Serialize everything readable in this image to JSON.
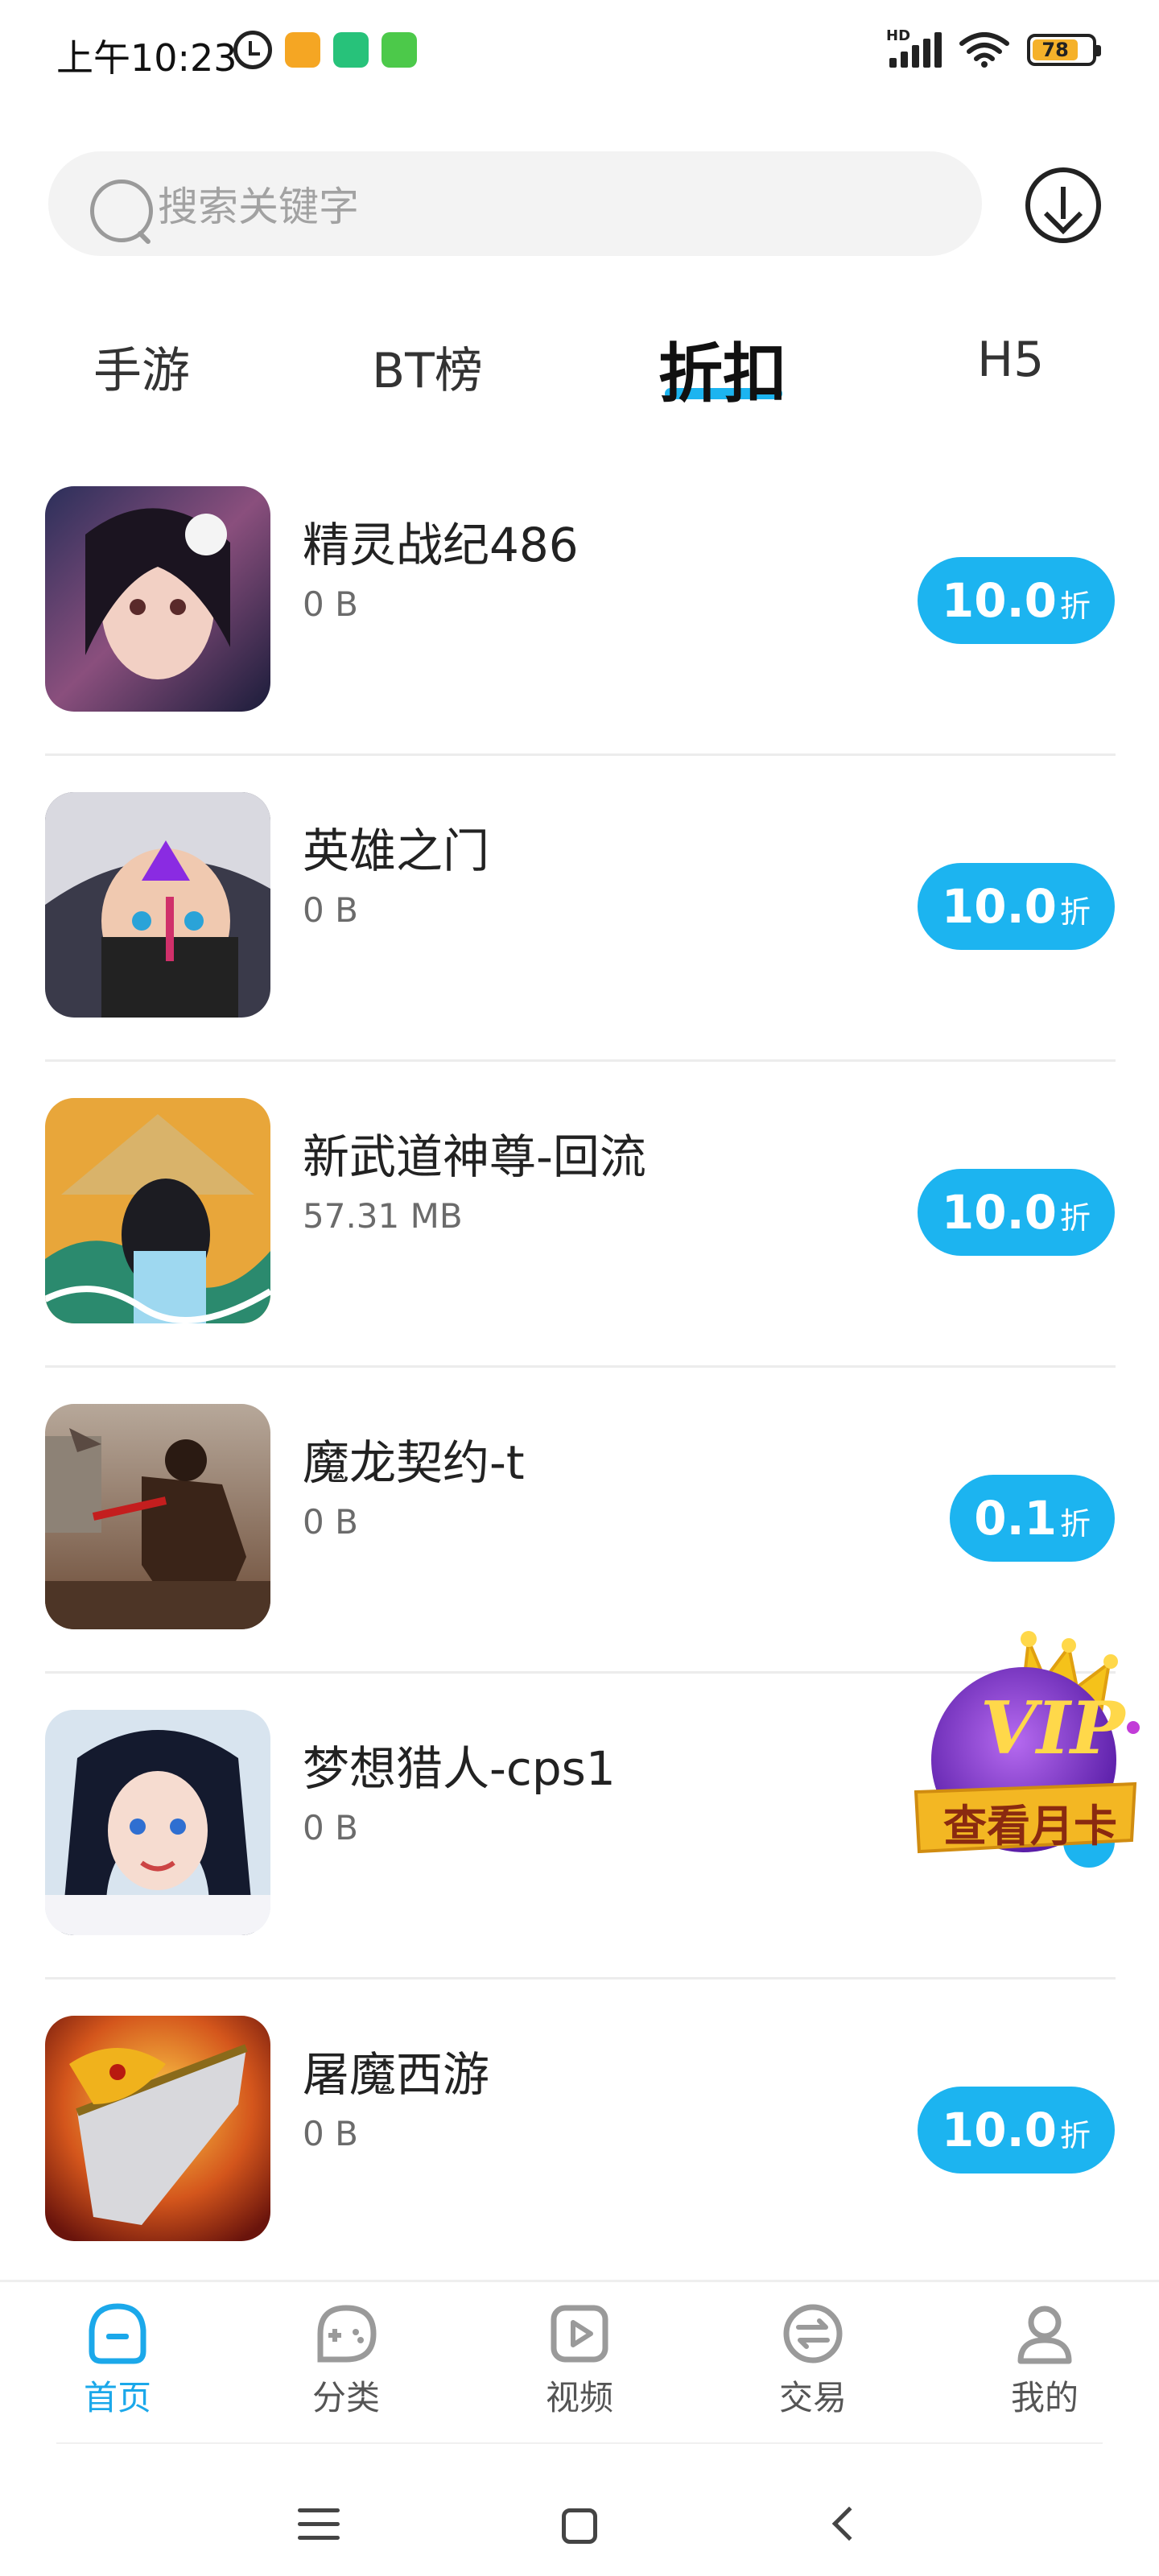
{
  "status_bar": {
    "time": "上午10:23",
    "battery": "78",
    "network": "HD"
  },
  "search": {
    "placeholder": "搜索关键字"
  },
  "tabs": [
    {
      "label": "手游"
    },
    {
      "label": "BT榜"
    },
    {
      "label": "折扣",
      "active": true
    },
    {
      "label": "H5"
    }
  ],
  "games": [
    {
      "name": "精灵战纪486",
      "size": "0 B",
      "discount": "10.0",
      "unit": "折"
    },
    {
      "name": "英雄之门",
      "size": "0 B",
      "discount": "10.0",
      "unit": "折"
    },
    {
      "name": "新武道神尊-回流",
      "size": "57.31 MB",
      "discount": "10.0",
      "unit": "折"
    },
    {
      "name": "魔龙契约-t",
      "size": "0 B",
      "discount": "0.1",
      "unit": "折"
    },
    {
      "name": "梦想猎人-cps1",
      "size": "0 B",
      "discount": "",
      "unit": ""
    },
    {
      "name": "屠魔西游",
      "size": "0 B",
      "discount": "10.0",
      "unit": "折"
    }
  ],
  "vip_badge": {
    "logo": "VIP",
    "label": "查看月卡"
  },
  "bottom_nav": [
    {
      "label": "首页",
      "icon": "home-icon",
      "active": true
    },
    {
      "label": "分类",
      "icon": "category-icon"
    },
    {
      "label": "视频",
      "icon": "video-icon"
    },
    {
      "label": "交易",
      "icon": "trade-icon"
    },
    {
      "label": "我的",
      "icon": "profile-icon"
    }
  ],
  "colors": {
    "accent": "#1cb4f0",
    "nav_active": "#1ba8ea",
    "battery": "#f5b12a",
    "vip_purple": "#7b2fc8",
    "vip_gold": "#f5c21a"
  }
}
